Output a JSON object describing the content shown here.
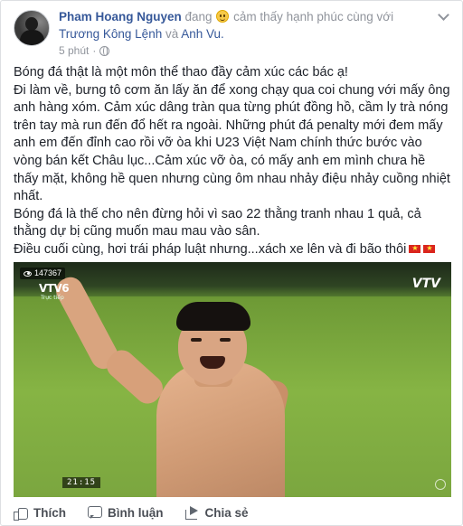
{
  "post": {
    "author_name": "Pham Hoang Nguyen",
    "status_prefix": "đang",
    "feeling_icon": "smile-emoji-icon",
    "feeling_text": "cảm thấy hạnh phúc cùng với",
    "tagged_1": "Trương Kông Lệnh",
    "tagged_and": "và",
    "tagged_2": "Anh Vu.",
    "time": "5 phút",
    "meta_separator": "·",
    "paragraph_1": "Bóng đá thật là một môn thể thao đầy cảm xúc các bác ạ!",
    "paragraph_2": "Đi làm về, bưng tô cơm ăn lấy ăn để xong chạy qua coi chung với mấy ông anh hàng xóm. Cảm xúc dâng tràn qua từng phút đồng hồ, cầm ly trà nóng trên tay mà run đến đổ hết ra ngoài. Những phút đá penalty mới đem mấy anh em đến đỉnh cao rồi vỡ òa khi U23 Việt Nam chính thức bước vào vòng bán kết Châu lục...Cảm xúc vỡ òa, có mấy anh em mình chưa hề thấy mặt, không hề quen nhưng cùng ôm nhau nhảy điệu nhảy cuồng nhiệt nhất.",
    "paragraph_3": "Bóng đá là thế cho nên đừng hỏi vì sao 22 thằng tranh nhau 1 quả, cả thằng dự bị cũng muốn mau mau vào sân.",
    "paragraph_4": "Điều cuối cùng, hơi trái pháp luật nhưng...xách xe lên và đi bão thôi"
  },
  "video": {
    "view_count": "147367",
    "channel_name": "VTV6",
    "channel_sub": "Trực tiếp",
    "broadcaster_logo": "VTV",
    "clock": "21:15"
  },
  "actions": {
    "like_label": "Thích",
    "comment_label": "Bình luận",
    "share_label": "Chia sẻ"
  },
  "colors": {
    "link": "#365899",
    "meta": "#90949c",
    "text": "#1d2129",
    "flag_red": "#da251d",
    "flag_star": "#ffeb3b"
  }
}
